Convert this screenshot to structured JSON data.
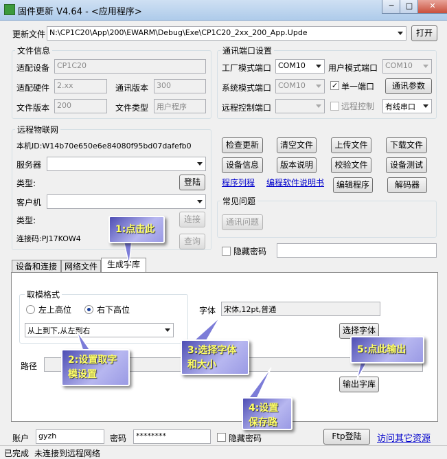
{
  "window": {
    "title": "固件更新 V4.64 - <应用程序>",
    "min": "─",
    "max": "□",
    "close": "✕"
  },
  "firmware": {
    "label": "更新文件",
    "path": "N:\\CP1C20\\App\\200\\EWARM\\Debug\\Exe\\CP1C20_2xx_200_App.Upde",
    "open_btn": "打开"
  },
  "file_info": {
    "title": "文件信息",
    "device_label": "适配设备",
    "device": "CP1C20",
    "hw_label": "适配硬件",
    "hw": "2.xx",
    "comm_ver_label": "通讯版本",
    "comm_ver": "300",
    "file_ver_label": "文件版本",
    "file_ver": "200",
    "file_type_label": "文件类型",
    "file_type": "用户程序"
  },
  "comm": {
    "title": "通讯端口设置",
    "factory_label": "工厂模式端口",
    "factory": "COM10",
    "user_label": "用户模式端口",
    "user": "COM10",
    "system_label": "系统模式端口",
    "system": "COM10",
    "single_label": "单一端口",
    "params_btn": "通讯参数",
    "remote_label": "远程控制端口",
    "remote_ctl_label": "远程控制",
    "cable": "有线串口"
  },
  "iot": {
    "title": "远程物联网",
    "machine_id_label": "本机ID:",
    "machine_id": "W14b70e650e6e84080f95bd07dafefb0",
    "server_label": "服务器",
    "type_label": "类型:",
    "login_btn": "登陆",
    "client_label": "客户机",
    "type2_label": "类型:",
    "connect_btn": "连接",
    "code_label": "连接码:",
    "code": "PJ17KOW4",
    "query_btn": "查询"
  },
  "actions": {
    "check_update": "检查更新",
    "clear_file": "清空文件",
    "upload_file": "上传文件",
    "download_file": "下载文件",
    "device_info": "设备信息",
    "version_note": "版本说明",
    "verify_file": "校验文件",
    "device_test": "设备测试",
    "program_list": "程序列程",
    "edit_manual": "编程软件说明书",
    "edit_program": "编辑程序",
    "decoder": "解码器"
  },
  "faq": {
    "title": "常见问题",
    "comm_issue": "通讯问题"
  },
  "hide_pwd_top": "隐藏密码",
  "tabs": [
    {
      "label": "设备和连接"
    },
    {
      "label": "网络文件"
    },
    {
      "label": "生成字库"
    }
  ],
  "font_tab": {
    "mode_title": "取模格式",
    "opt_top_left": "左上高位",
    "opt_top_right": "右下高位",
    "scan_order": "从上到下,从左到右",
    "font_label": "字体",
    "font_value": "宋体,12pt,普通",
    "choose_font_btn": "选择字体",
    "path_label": "路径",
    "export_btn": "输出字库"
  },
  "bottom": {
    "account_label": "账户",
    "account": "gyzh",
    "pwd_label": "密码",
    "pwd": "********",
    "hide_pwd": "隐藏密码",
    "ftp_btn": "Ftp登陆",
    "visit_link": "访问其它资源"
  },
  "status": {
    "left": "已完成",
    "right": "未连接到远程网络"
  },
  "callouts": {
    "c1": "1:点击此",
    "c2_line1": "2:设置取字",
    "c2_line2": "模设置",
    "c3_line1": "3:选择字体",
    "c3_line2": "和大小",
    "c4_line1": "4:设置",
    "c4_line2": "保存路",
    "c5": "5:点此输出"
  }
}
